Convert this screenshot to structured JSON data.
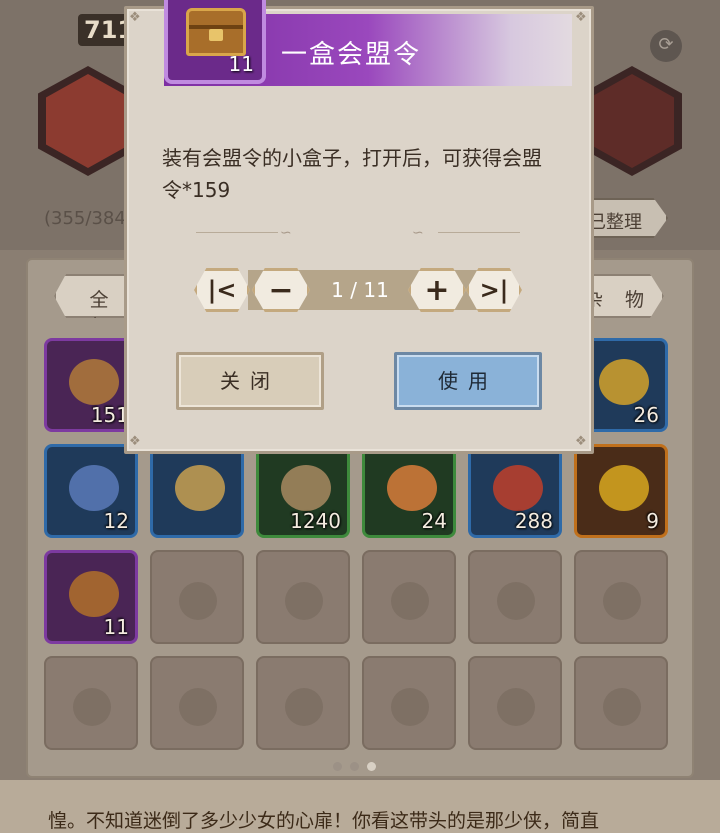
{
  "background": {
    "top_number": "711",
    "capacity_text": "(355/384",
    "tidy_button": "已整理",
    "filter_left": "全 部",
    "filter_right": "杂 物",
    "bottom_text": "惶。不知道迷倒了多少少女的心扉！你看这带头的是那少侠，简直",
    "page_dots": 3,
    "active_dot": 2,
    "slots": [
      {
        "rarity": "purple",
        "qty": "151",
        "art_color": "#b07a3a"
      },
      {
        "rarity": "hidden",
        "qty": ""
      },
      {
        "rarity": "hidden",
        "qty": ""
      },
      {
        "rarity": "hidden",
        "qty": ""
      },
      {
        "rarity": "hidden",
        "qty": ""
      },
      {
        "rarity": "blue",
        "qty": "26",
        "art_color": "#d4a22a"
      },
      {
        "rarity": "blue",
        "qty": "12",
        "art_color": "#5a7ab8"
      },
      {
        "rarity": "blue",
        "qty": "",
        "art_color": "#c8a050"
      },
      {
        "rarity": "green",
        "qty": "1240",
        "art_color": "#a88a60"
      },
      {
        "rarity": "green",
        "qty": "24",
        "art_color": "#d87c3a"
      },
      {
        "rarity": "blue",
        "qty": "288",
        "art_color": "#c0402a"
      },
      {
        "rarity": "orange",
        "qty": "9",
        "art_color": "#d8a820"
      },
      {
        "rarity": "purple",
        "qty": "11",
        "art_color": "#b0702a"
      },
      {
        "rarity": "empty",
        "qty": ""
      },
      {
        "rarity": "empty",
        "qty": ""
      },
      {
        "rarity": "empty",
        "qty": ""
      },
      {
        "rarity": "empty",
        "qty": ""
      },
      {
        "rarity": "empty",
        "qty": ""
      },
      {
        "rarity": "empty",
        "qty": ""
      },
      {
        "rarity": "empty",
        "qty": ""
      },
      {
        "rarity": "empty",
        "qty": ""
      },
      {
        "rarity": "empty",
        "qty": ""
      },
      {
        "rarity": "empty",
        "qty": ""
      },
      {
        "rarity": "empty",
        "qty": ""
      }
    ]
  },
  "dialog": {
    "title": "一盒会盟令",
    "item_qty": "11",
    "description": "装有会盟令的小盒子，打开后，可获得会盟令*159",
    "stepper": {
      "first_icon": "skip-first-icon",
      "minus_icon": "minus-icon",
      "plus_icon": "plus-icon",
      "last_icon": "skip-last-icon",
      "value": "1 / 11"
    },
    "close_label": "关闭",
    "use_label": "使用"
  },
  "colors": {
    "title_purple": "#7d2fa3",
    "use_button": "#8ab2d8",
    "close_button": "#d8cdb9"
  }
}
